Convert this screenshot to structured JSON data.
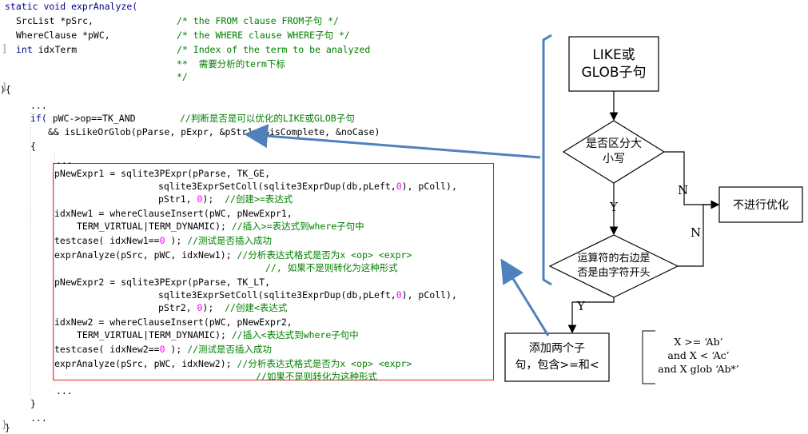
{
  "code": {
    "gutter": [
      "]",
      "]",
      "}"
    ],
    "lines": [
      {
        "segments": [
          {
            "t": "static void exprAnalyze(",
            "c": "kw"
          }
        ]
      },
      {
        "segments": [
          {
            "t": "SrcList *pSrc,",
            "c": ""
          }
        ]
      },
      {
        "segments": [
          {
            "t": "/* the FROM clause FROM子句 */",
            "c": "cm"
          }
        ]
      },
      {
        "segments": [
          {
            "t": "WhereClause *pWC,",
            "c": ""
          }
        ]
      },
      {
        "segments": [
          {
            "t": "/* the WHERE clause WHERE子句 */",
            "c": "cm"
          }
        ]
      },
      {
        "segments": [
          {
            "t": "int",
            "c": "kw"
          },
          {
            "t": " idxTerm",
            "c": ""
          }
        ]
      },
      {
        "segments": [
          {
            "t": "/* Index of the term to be analyzed",
            "c": "cm"
          }
        ]
      },
      {
        "segments": [
          {
            "t": "**  需要分析的term下标",
            "c": "cm"
          }
        ]
      },
      {
        "segments": [
          {
            "t": "*/",
            "c": "cm"
          }
        ]
      },
      {
        "segments": [
          {
            "t": "){",
            "c": ""
          }
        ]
      },
      {
        "segments": [
          {
            "t": "...",
            "c": ""
          }
        ]
      },
      {
        "segments": [
          {
            "t": "if(",
            "c": "kw"
          },
          {
            "t": " pWC->op==TK_AND",
            "c": ""
          }
        ]
      },
      {
        "segments": [
          {
            "t": "//判断是否是可以优化的LIKE或GLOB子句",
            "c": "cm"
          }
        ]
      },
      {
        "segments": [
          {
            "t": "&& isLikeOrGlob(pParse, pExpr, &pStr1, &isComplete, &noCase)",
            "c": ""
          }
        ]
      },
      {
        "segments": [
          {
            "t": "{",
            "c": ""
          }
        ]
      },
      {
        "segments": [
          {
            "t": "...",
            "c": ""
          }
        ]
      },
      {
        "segments": [
          {
            "t": "pNewExpr1 = sqlite3PExpr(pParse, TK_GE,",
            "c": ""
          }
        ]
      },
      {
        "segments": [
          {
            "t": "sqlite3ExprSetColl(sqlite3ExprDup(db,pLeft,",
            "c": ""
          },
          {
            "t": "0",
            "c": "num"
          },
          {
            "t": "), pColl),",
            "c": ""
          }
        ]
      },
      {
        "segments": [
          {
            "t": "pStr1, ",
            "c": ""
          },
          {
            "t": "0",
            "c": "num"
          },
          {
            "t": ");  ",
            "c": ""
          },
          {
            "t": "//创建>=表达式",
            "c": "cm"
          }
        ]
      },
      {
        "segments": [
          {
            "t": "idxNew1 = whereClauseInsert(pWC, pNewExpr1,",
            "c": ""
          }
        ]
      },
      {
        "segments": [
          {
            "t": "TERM_VIRTUAL|TERM_DYNAMIC); ",
            "c": ""
          },
          {
            "t": "//插入>=表达式到where子句中",
            "c": "cm"
          }
        ]
      },
      {
        "segments": [
          {
            "t": "testcase( idxNew1==",
            "c": ""
          },
          {
            "t": "0",
            "c": "num"
          },
          {
            "t": " ); ",
            "c": ""
          },
          {
            "t": "//测试是否插入成功",
            "c": "cm"
          }
        ]
      },
      {
        "segments": [
          {
            "t": "exprAnalyze(pSrc, pWC, idxNew1); ",
            "c": ""
          },
          {
            "t": "//分析表达式格式是否为x <op> <expr>",
            "c": "cm"
          }
        ]
      },
      {
        "segments": [
          {
            "t": "//, 如果不是则转化为这种形式",
            "c": "cm"
          }
        ]
      },
      {
        "segments": [
          {
            "t": "pNewExpr2 = sqlite3PExpr(pParse, TK_LT,",
            "c": ""
          }
        ]
      },
      {
        "segments": [
          {
            "t": "sqlite3ExprSetColl(sqlite3ExprDup(db,pLeft,",
            "c": ""
          },
          {
            "t": "0",
            "c": "num"
          },
          {
            "t": "), pColl),",
            "c": ""
          }
        ]
      },
      {
        "segments": [
          {
            "t": "pStr2, ",
            "c": ""
          },
          {
            "t": "0",
            "c": "num"
          },
          {
            "t": ");  ",
            "c": ""
          },
          {
            "t": "//创建<表达式",
            "c": "cm"
          }
        ]
      },
      {
        "segments": [
          {
            "t": "idxNew2 = whereClauseInsert(pWC, pNewExpr2,",
            "c": ""
          }
        ]
      },
      {
        "segments": [
          {
            "t": "TERM_VIRTUAL|TERM_DYNAMIC); ",
            "c": ""
          },
          {
            "t": "//插入<表达式到where子句中",
            "c": "cm"
          }
        ]
      },
      {
        "segments": [
          {
            "t": "testcase( idxNew2==",
            "c": ""
          },
          {
            "t": "0",
            "c": "num"
          },
          {
            "t": " ); ",
            "c": ""
          },
          {
            "t": "//测试是否插入成功",
            "c": "cm"
          }
        ]
      },
      {
        "segments": [
          {
            "t": "exprAnalyze(pSrc, pWC, idxNew2); ",
            "c": ""
          },
          {
            "t": "//分析表达式格式是否为x <op> <expr>",
            "c": "cm"
          }
        ]
      },
      {
        "segments": [
          {
            "t": "//如果不是则转化为这种形式",
            "c": "cm"
          }
        ]
      },
      {
        "segments": [
          {
            "t": "...",
            "c": ""
          }
        ]
      },
      {
        "segments": [
          {
            "t": "}",
            "c": ""
          }
        ]
      },
      {
        "segments": [
          {
            "t": "...",
            "c": ""
          }
        ]
      },
      {
        "segments": [
          {
            "t": "}",
            "c": ""
          }
        ]
      }
    ]
  },
  "flowchart": {
    "start": {
      "line1": "LIKE或",
      "line2": "GLOB子句"
    },
    "decision1": {
      "line1": "是否区分大",
      "line2": "小写"
    },
    "decision2": {
      "line1": "运算符的右边是",
      "line2": "否是由字符开头"
    },
    "no_opt": "不进行优化",
    "action": {
      "line1": "添加两个子",
      "line2": "句，包含>=和<"
    },
    "labels": {
      "n1": "N",
      "n2": "N",
      "y1": "Y",
      "y2": "Y"
    },
    "example_lines": [
      "X >= ‘Ab’",
      "and X < ‘Ac’",
      "and X glob ‘Ab*’"
    ]
  },
  "colors": {
    "flow_arrow": "#4f81bd",
    "red_box": "#e02020",
    "code_keyword": "#00008b",
    "code_comment": "#008000",
    "code_number": "#ff00ff"
  }
}
